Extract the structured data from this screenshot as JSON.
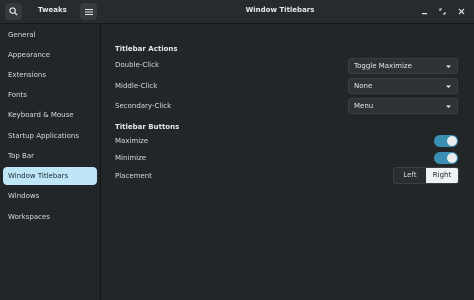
{
  "header": {
    "app_title": "Tweaks",
    "window_title": "Window Titlebars"
  },
  "sidebar": {
    "items": [
      {
        "label": "General"
      },
      {
        "label": "Appearance"
      },
      {
        "label": "Extensions"
      },
      {
        "label": "Fonts"
      },
      {
        "label": "Keyboard & Mouse"
      },
      {
        "label": "Startup Applications"
      },
      {
        "label": "Top Bar"
      },
      {
        "label": "Window Titlebars"
      },
      {
        "label": "Windows"
      },
      {
        "label": "Workspaces"
      }
    ],
    "active": "Window Titlebars"
  },
  "actions": {
    "title": "Titlebar Actions",
    "double_click": {
      "label": "Double-Click",
      "value": "Toggle Maximize"
    },
    "middle_click": {
      "label": "Middle-Click",
      "value": "None"
    },
    "secondary_click": {
      "label": "Secondary-Click",
      "value": "Menu"
    }
  },
  "buttons": {
    "title": "Titlebar Buttons",
    "maximize": {
      "label": "Maximize",
      "enabled": true
    },
    "minimize": {
      "label": "Minimize",
      "enabled": true
    },
    "placement": {
      "label": "Placement",
      "options": [
        "Left",
        "Right"
      ],
      "selected": "Right"
    }
  },
  "colors": {
    "accent": "#3b8fb3",
    "active_sidebar": "#bfe6f7",
    "background": "#222629"
  }
}
